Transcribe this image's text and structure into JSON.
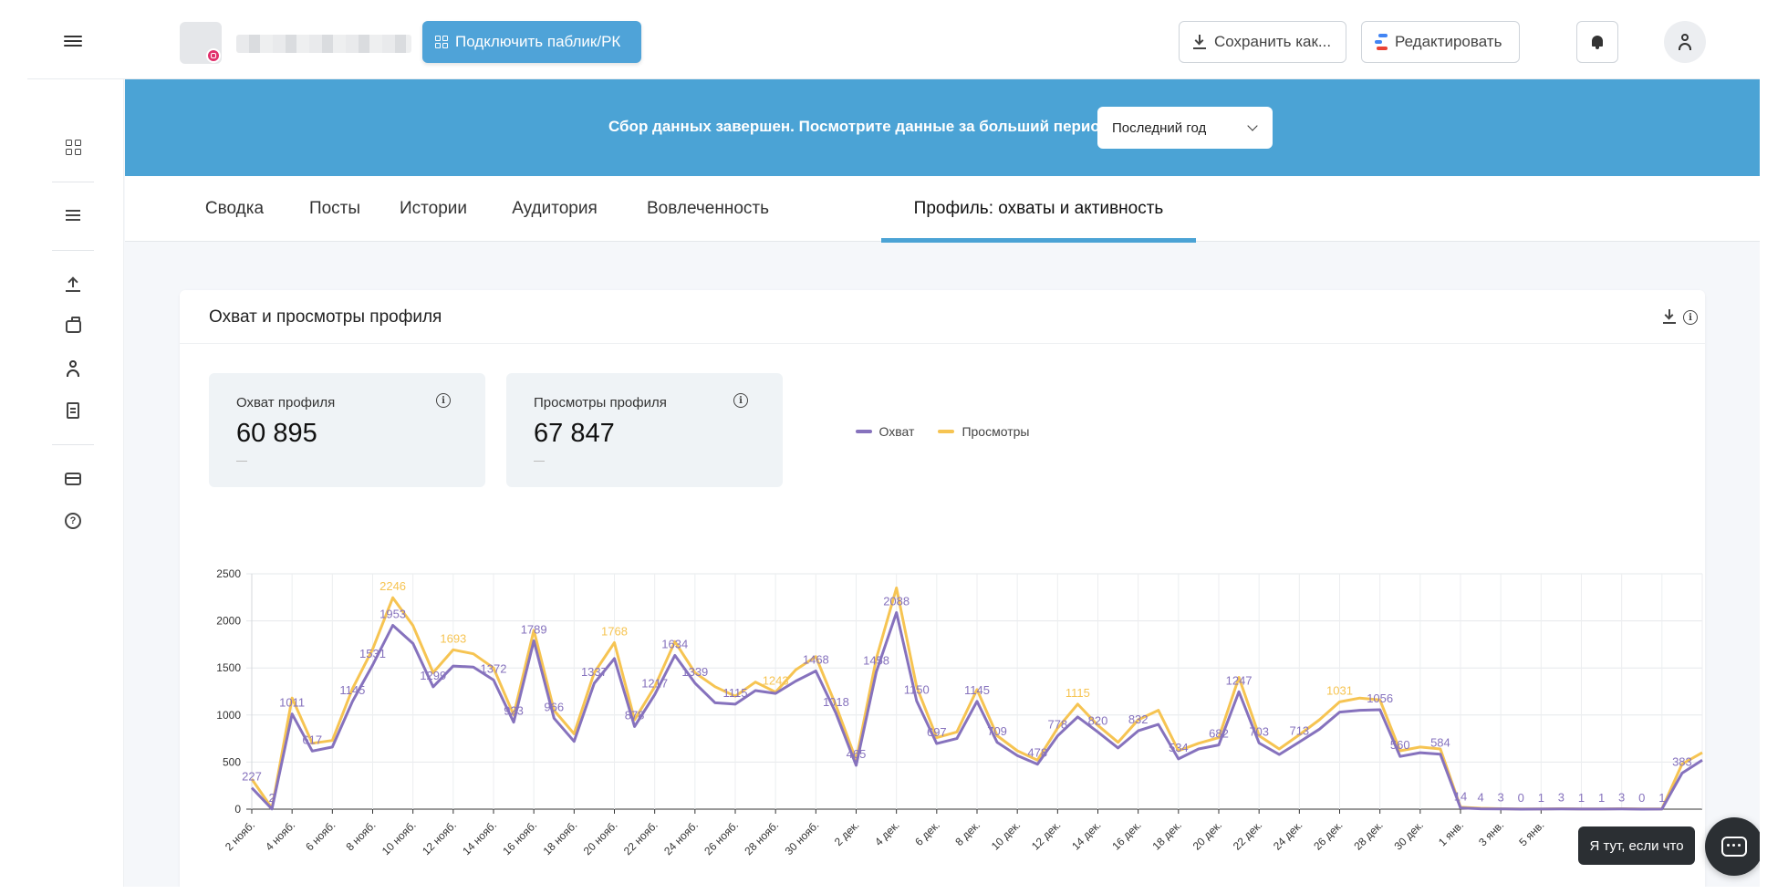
{
  "header": {
    "connect_label": "Подключить паблик/РК",
    "save_label": "Сохранить как...",
    "edit_label": "Редактировать"
  },
  "banner": {
    "text": "Сбор данных завершен. Посмотрите данные за больший период",
    "period_value": "Последний год"
  },
  "tabs": [
    {
      "label": "Сводка"
    },
    {
      "label": "Посты"
    },
    {
      "label": "Истории"
    },
    {
      "label": "Аудитория"
    },
    {
      "label": "Вовлеченность"
    },
    {
      "label": "Профиль: охваты и активность",
      "active": true
    }
  ],
  "card": {
    "title": "Охват и просмотры профиля",
    "metrics": [
      {
        "label": "Охват профиля",
        "value": "60 895",
        "change": "—"
      },
      {
        "label": "Просмотры профиля",
        "value": "67 847",
        "change": "—"
      }
    ]
  },
  "chat": {
    "tooltip": "Я тут, если что"
  },
  "colors": {
    "accent": "#4ba3d5",
    "reach": "#8672bd",
    "views": "#f6c452"
  },
  "icons": [
    "menu-icon",
    "grid-icon",
    "list-icon",
    "upload-icon",
    "briefcase-icon",
    "user-icon",
    "receipt-icon",
    "card-icon",
    "help-icon",
    "download-icon",
    "info-icon",
    "bell-icon",
    "chat-icon"
  ],
  "chart_data": {
    "type": "line",
    "legend": [
      "Охват",
      "Просмотры"
    ],
    "legend_position": "top-center",
    "grid": true,
    "ylim": [
      0,
      2500
    ],
    "yticks": [
      0,
      500,
      1000,
      1500,
      2000,
      2500
    ],
    "x_labels": [
      "2 нояб.",
      "4 нояб.",
      "6 нояб.",
      "8 нояб.",
      "10 нояб.",
      "12 нояб.",
      "14 нояб.",
      "16 нояб.",
      "18 нояб.",
      "20 нояб.",
      "22 нояб.",
      "24 нояб.",
      "26 нояб.",
      "28 нояб.",
      "30 нояб.",
      "2 дек.",
      "4 дек.",
      "6 дек.",
      "8 дек.",
      "10 дек.",
      "12 дек.",
      "14 дек.",
      "16 дек.",
      "18 дек.",
      "20 дек.",
      "22 дек.",
      "24 дек.",
      "26 дек.",
      "28 дек.",
      "30 дек.",
      "1 янв.",
      "3 янв.",
      "5 янв."
    ],
    "series": [
      {
        "name": "Охват",
        "color": "#8672bd",
        "values": [
          227,
          2,
          1011,
          617,
          660,
          1145,
          1531,
          1953,
          1760,
          1299,
          1520,
          1510,
          1372,
          923,
          1789,
          966,
          720,
          1337,
          1600,
          878,
          1217,
          1634,
          1339,
          1130,
          1115,
          1260,
          1230,
          1360,
          1468,
          1018,
          465,
          1458,
          2088,
          1150,
          697,
          750,
          1145,
          709,
          570,
          478,
          778,
          980,
          820,
          650,
          832,
          900,
          534,
          640,
          682,
          1247,
          703,
          580,
          713,
          850,
          1031,
          1050,
          1056,
          560,
          600,
          584,
          14,
          4,
          3,
          0,
          1,
          3,
          1,
          1,
          3,
          0,
          1,
          383,
          520
        ],
        "labels": {
          "0": 227,
          "1": 2,
          "2": 1011,
          "3": 617,
          "5": 1145,
          "6": 1531,
          "7": 1953,
          "9": 1299,
          "12": 1372,
          "13": 923,
          "14": 1789,
          "15": 966,
          "17": 1337,
          "19": 878,
          "20": 1217,
          "21": 1634,
          "22": 1339,
          "24": 1115,
          "28": 1468,
          "29": 1018,
          "30": 465,
          "31": 1458,
          "32": 2088,
          "33": 1150,
          "34": 697,
          "36": 1145,
          "37": 709,
          "39": 478,
          "40": 778,
          "42": 820,
          "44": 832,
          "46": 534,
          "48": 682,
          "49": 1247,
          "50": 703,
          "52": 713,
          "56": 1056,
          "57": 560,
          "59": 584,
          "60": 14,
          "61": 4,
          "62": 3,
          "63": 0,
          "64": 1,
          "65": 3,
          "66": 1,
          "67": 1,
          "68": 3,
          "69": 0,
          "70": 1,
          "71": 383
        }
      },
      {
        "name": "Просмотры",
        "color": "#f6c452",
        "values": [
          320,
          10,
          1180,
          700,
          730,
          1280,
          1700,
          2246,
          1950,
          1450,
          1693,
          1650,
          1500,
          1000,
          1900,
          1050,
          800,
          1450,
          1768,
          950,
          1300,
          1780,
          1450,
          1300,
          1200,
          1350,
          1243,
          1480,
          1620,
          1100,
          520,
          1600,
          2350,
          1300,
          760,
          820,
          1270,
          780,
          620,
          520,
          860,
          1115,
          890,
          710,
          950,
          1050,
          620,
          700,
          760,
          1400,
          780,
          640,
          790,
          950,
          1140,
          1180,
          1160,
          620,
          660,
          640,
          20,
          10,
          5,
          2,
          3,
          5,
          3,
          3,
          5,
          2,
          3,
          480,
          600
        ],
        "labels": {
          "7": 2246,
          "10": 1693,
          "18": 1768,
          "26": 1243,
          "41": 1115,
          "54": 1031
        }
      }
    ]
  }
}
